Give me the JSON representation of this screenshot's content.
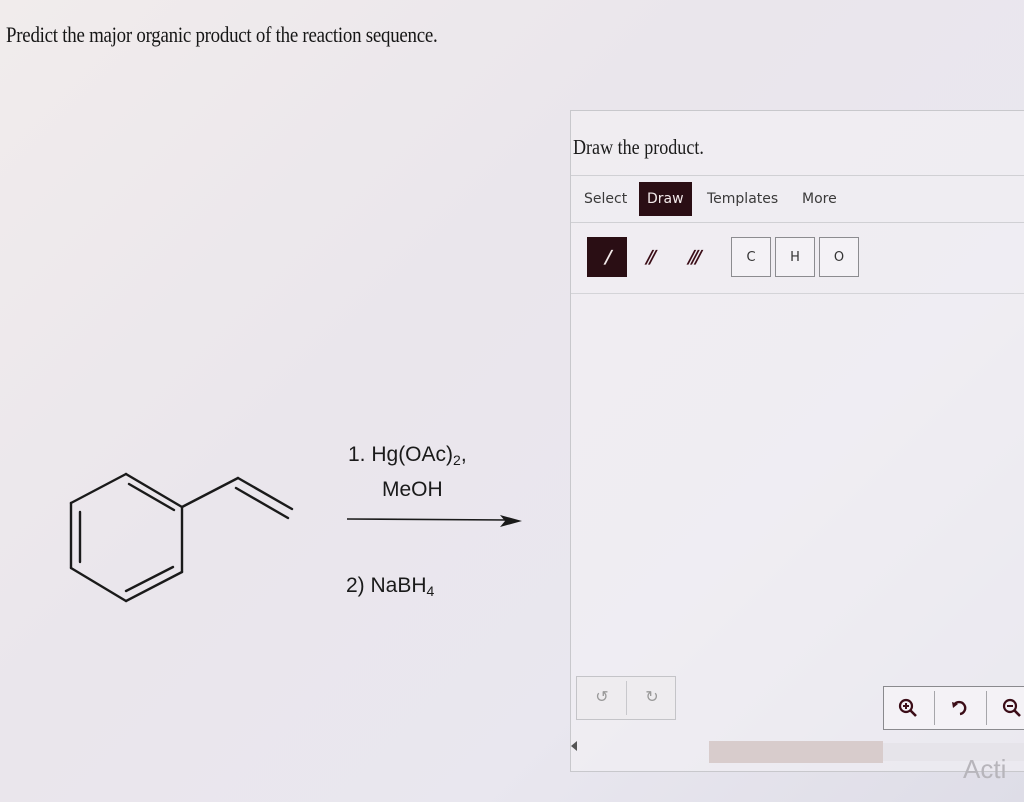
{
  "question": {
    "text": "Predict the major organic product of the reaction sequence."
  },
  "reaction": {
    "step1_line1": "1. Hg(OAc)",
    "step1_sub": "2",
    "step1_end": ",",
    "step1_line2": "MeOH",
    "step2_text": "2) NaBH",
    "step2_sub": "4"
  },
  "editor": {
    "title": "Draw the product.",
    "tabs": {
      "select": "Select",
      "draw": "Draw",
      "templates": "Templates",
      "more": "More"
    },
    "atoms": {
      "carbon": "C",
      "hydrogen": "H",
      "oxygen": "O"
    },
    "watermark": "Acti"
  },
  "colors": {
    "accent": "#2a0e14",
    "zoom_icon": "#3b0d17"
  }
}
